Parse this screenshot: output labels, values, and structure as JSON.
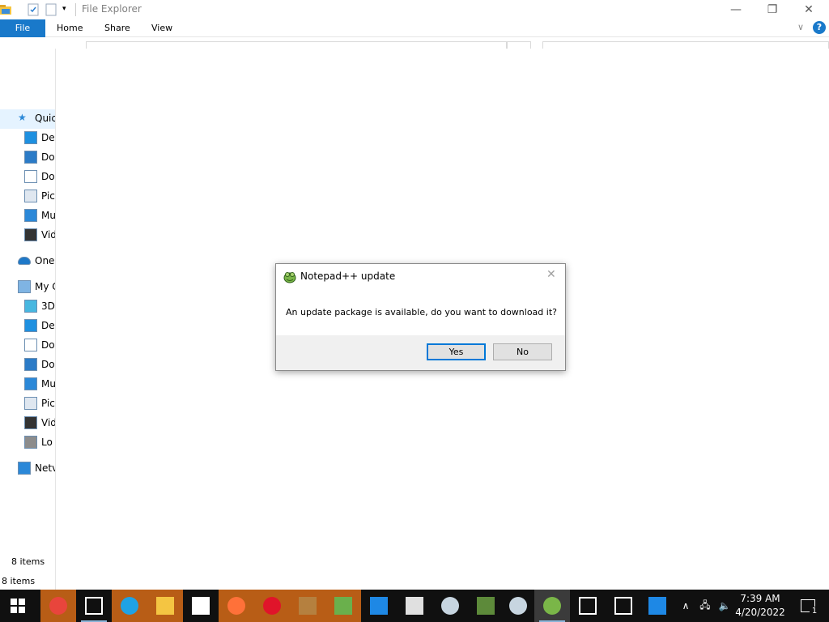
{
  "window": {
    "title": "File Explorer",
    "min_icon": "minimize-icon",
    "max_icon": "restore-icon",
    "close_icon": "close-icon"
  },
  "ribbon": {
    "tabs": [
      {
        "label": "File"
      },
      {
        "label": "Home"
      },
      {
        "label": "Share"
      },
      {
        "label": "View"
      }
    ]
  },
  "nav": {
    "items": [
      {
        "label": "Quic",
        "icon": "star-icon"
      },
      {
        "label": "De",
        "icon": "desktop-icon"
      },
      {
        "label": "Do",
        "icon": "download-icon"
      },
      {
        "label": "Do",
        "icon": "document-icon"
      },
      {
        "label": "Pic",
        "icon": "pictures-icon"
      },
      {
        "label": "Mu",
        "icon": "music-icon"
      },
      {
        "label": "Vid",
        "icon": "video-icon"
      },
      {
        "label": "One",
        "icon": "onedrive-icon"
      },
      {
        "label": "My C",
        "icon": "computer-icon"
      },
      {
        "label": "3D",
        "icon": "cube-icon"
      },
      {
        "label": "De",
        "icon": "desktop-icon"
      },
      {
        "label": "Do",
        "icon": "document-icon"
      },
      {
        "label": "Do",
        "icon": "download-icon"
      },
      {
        "label": "Mu",
        "icon": "music-icon"
      },
      {
        "label": "Pic",
        "icon": "pictures-icon"
      },
      {
        "label": "Vid",
        "icon": "video-icon"
      },
      {
        "label": "Lo",
        "icon": "disk-icon"
      },
      {
        "label": "Netv",
        "icon": "network-icon"
      }
    ]
  },
  "status": {
    "items_top": "8 items",
    "items_bottom": "8 items"
  },
  "dialog": {
    "title": "Notepad++ update",
    "message": "An update package is available, do you want to download it?",
    "yes_label": "Yes",
    "no_label": "No"
  },
  "taskbar": {
    "time": "7:39 AM",
    "date": "4/20/2022",
    "notification_count": "1",
    "apps": [
      "chrome-icon",
      "calendar-icon",
      "edge-icon",
      "folder-icon",
      "store-icon",
      "firefox-icon",
      "opera-icon",
      "package-icon",
      "notepad-icon",
      "app-icon",
      "roblox-icon",
      "steam-icon",
      "minecraft-icon",
      "steam-icon",
      "notepadpp-icon",
      "calculator-icon",
      "camera-icon",
      "roblox-studio-icon"
    ]
  },
  "colors": {
    "accent": "#1979ca",
    "taskbar": "#101010",
    "dialog_footer": "#f0f0f0",
    "default_button_border": "#0078d7"
  }
}
